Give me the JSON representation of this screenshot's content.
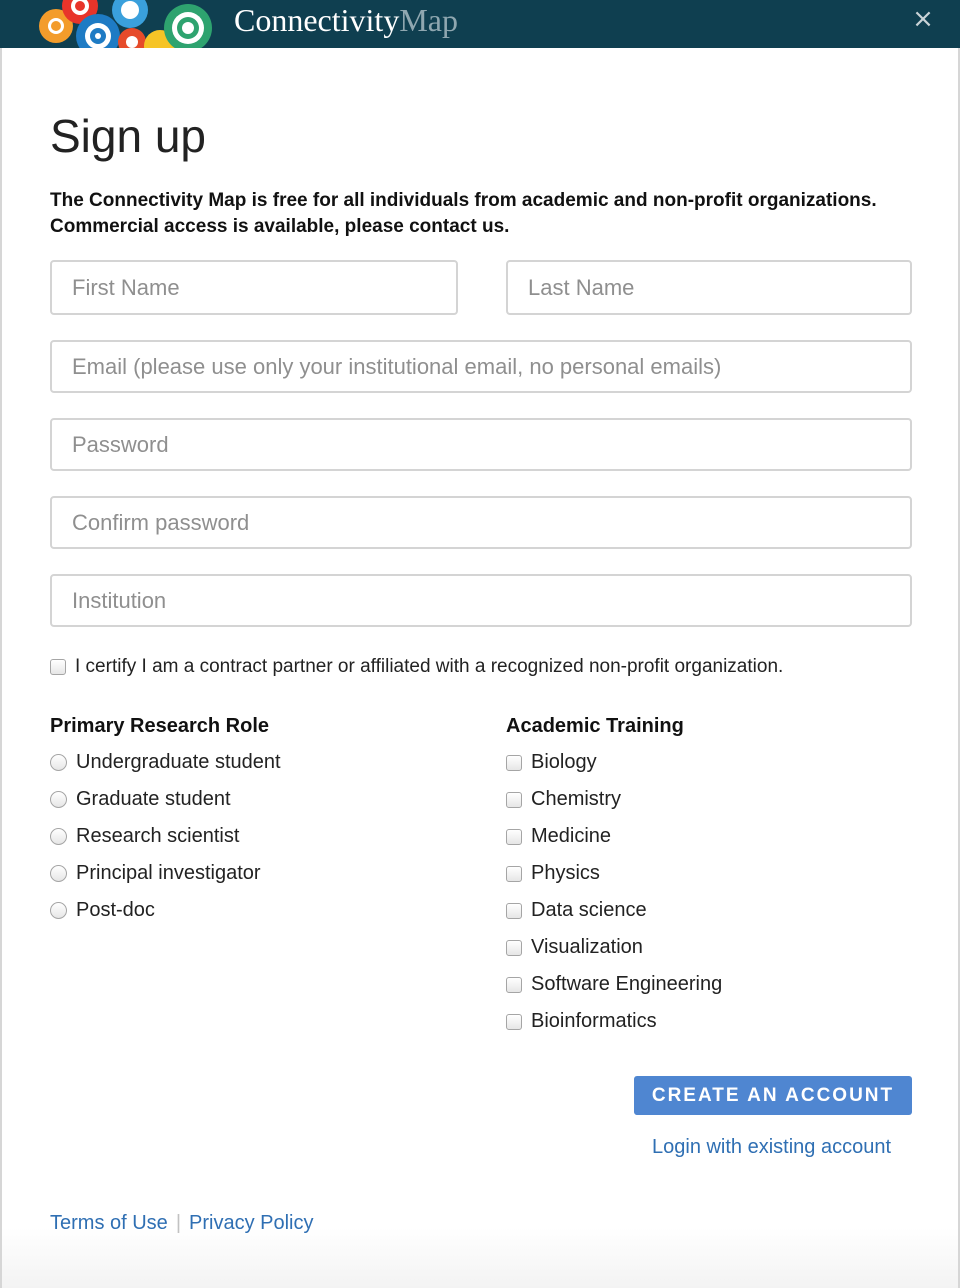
{
  "header": {
    "brand_primary": "Connectivity",
    "brand_secondary": "Map",
    "close_symbol": "×"
  },
  "form": {
    "title": "Sign up",
    "intro": "The Connectivity Map is free for all individuals from academic and non-profit organizations. Commercial access is available, please contact us.",
    "fields": {
      "first_name": {
        "placeholder": "First Name",
        "value": ""
      },
      "last_name": {
        "placeholder": "Last Name",
        "value": ""
      },
      "email": {
        "placeholder": "Email (please use only your institutional email, no personal emails)",
        "value": ""
      },
      "password": {
        "placeholder": "Password",
        "value": ""
      },
      "confirm_password": {
        "placeholder": "Confirm password",
        "value": ""
      },
      "institution": {
        "placeholder": "Institution",
        "value": ""
      }
    },
    "certify_label": "I certify I am a contract partner or affiliated with a recognized non-profit organization.",
    "certify_checked": false,
    "research_role": {
      "title": "Primary Research Role",
      "options": [
        "Undergraduate student",
        "Graduate student",
        "Research scientist",
        "Principal investigator",
        "Post-doc"
      ],
      "selected": null
    },
    "academic_training": {
      "title": "Academic Training",
      "options": [
        "Biology",
        "Chemistry",
        "Medicine",
        "Physics",
        "Data science",
        "Visualization",
        "Software Engineering",
        "Bioinformatics"
      ],
      "checked": []
    },
    "create_button": "CREATE AN ACCOUNT",
    "login_link": "Login with existing account"
  },
  "footer": {
    "terms": "Terms of Use",
    "separator": "|",
    "privacy": "Privacy Policy"
  },
  "colors": {
    "header_bg": "#0f3f50",
    "primary_button": "#4f86d1",
    "link": "#2f6fb3"
  },
  "icons": {
    "logo": "concentric-circles-logo",
    "close": "close-icon"
  }
}
